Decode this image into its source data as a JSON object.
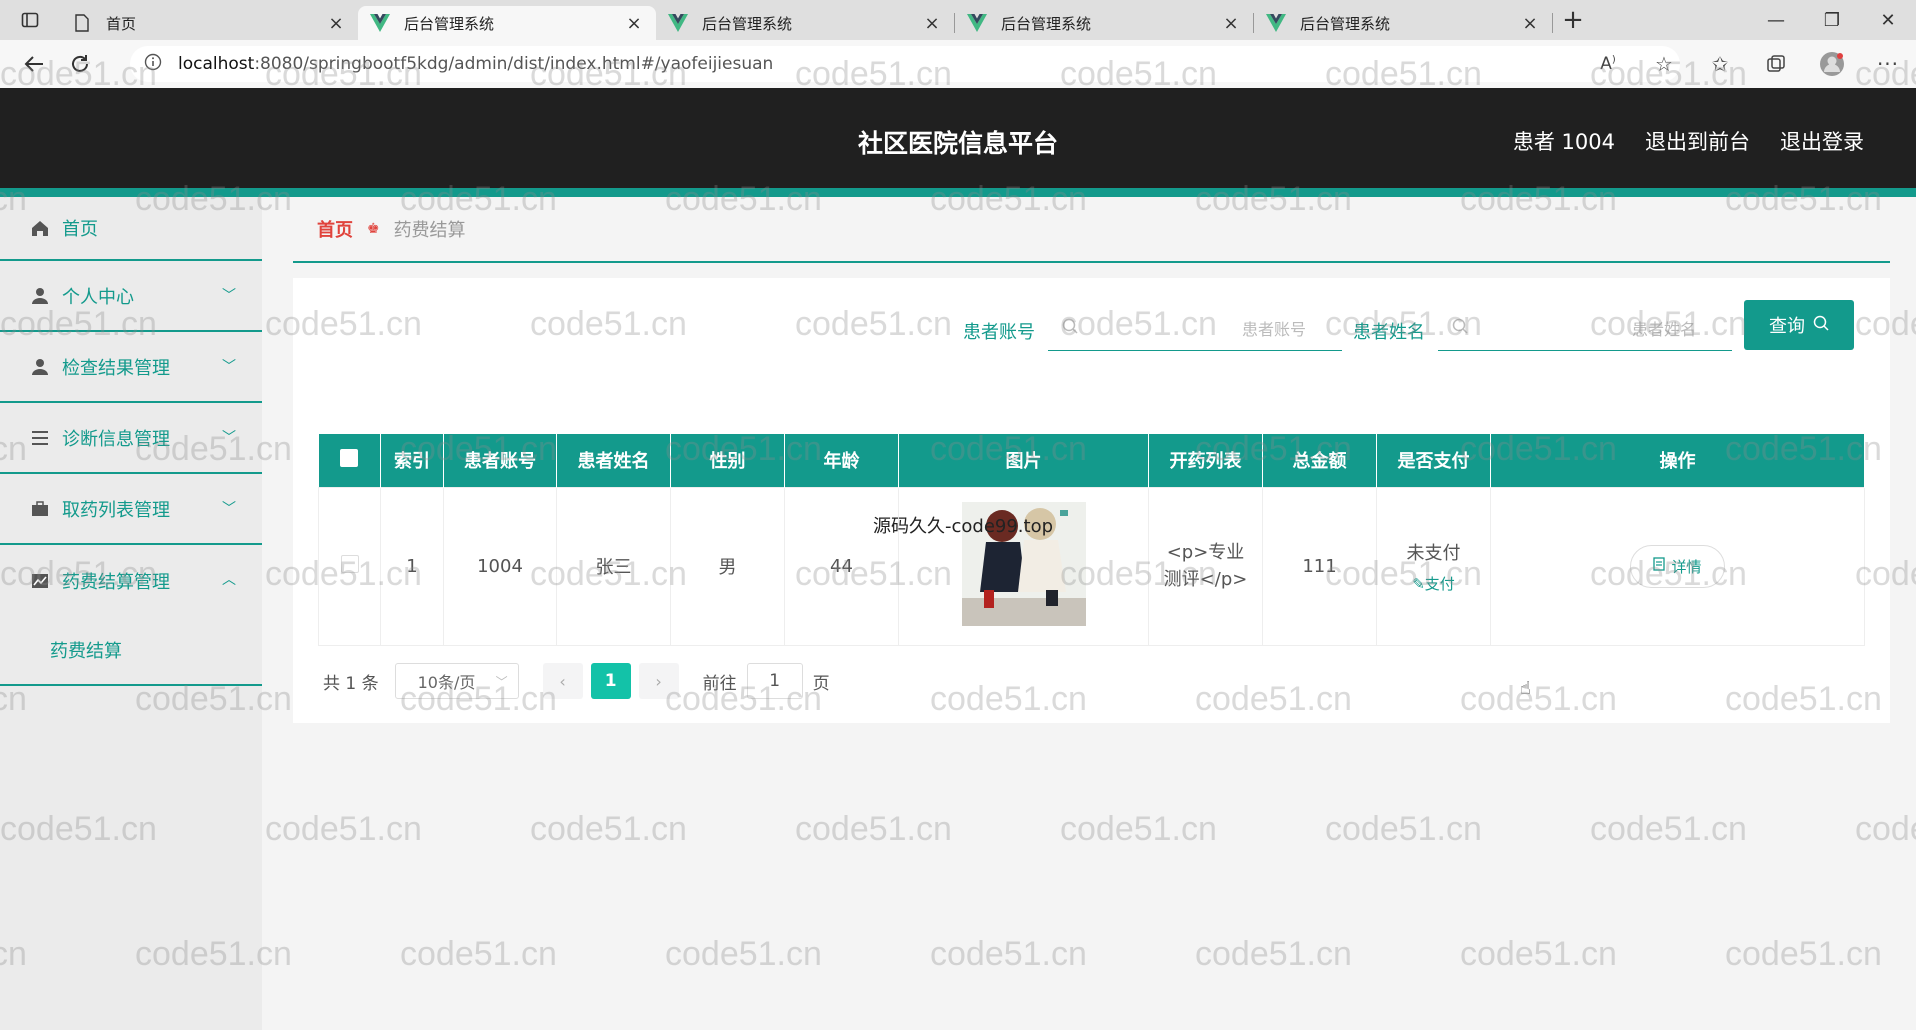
{
  "browser": {
    "tabs": [
      {
        "title": "首页",
        "active": false
      },
      {
        "title": "后台管理系统",
        "active": true
      },
      {
        "title": "后台管理系统",
        "active": false
      },
      {
        "title": "后台管理系统",
        "active": false
      },
      {
        "title": "后台管理系统",
        "active": false
      }
    ],
    "url_host": "localhost",
    "url_rest": ":8080/springbootf5kdg/admin/dist/index.html#/yaofeijiesuan"
  },
  "header": {
    "title": "社区医院信息平台",
    "user": "患者 1004",
    "to_front": "退出到前台",
    "logout": "退出登录"
  },
  "sidebar": {
    "items": [
      {
        "label": "首页",
        "icon": "home-icon"
      },
      {
        "label": "个人中心",
        "icon": "user-icon"
      },
      {
        "label": "检查结果管理",
        "icon": "user-icon"
      },
      {
        "label": "诊断信息管理",
        "icon": "list-icon"
      },
      {
        "label": "取药列表管理",
        "icon": "briefcase-icon"
      },
      {
        "label": "药费结算管理",
        "icon": "chart-icon"
      }
    ],
    "sub_items": [
      {
        "label": "药费结算"
      }
    ]
  },
  "breadcrumb": {
    "home": "首页",
    "current": "药费结算"
  },
  "search": {
    "account_label": "患者账号",
    "account_placeholder": "患者账号",
    "name_label": "患者姓名",
    "name_placeholder": "患者姓名",
    "button": "查询"
  },
  "table": {
    "headers": [
      "索引",
      "患者账号",
      "患者姓名",
      "性别",
      "年龄",
      "图片",
      "开药列表",
      "总金额",
      "是否支付",
      "操作"
    ],
    "rows": [
      {
        "index": "1",
        "account": "1004",
        "name": "张三",
        "gender": "男",
        "age": "44",
        "image_caption": "源码久久-code99.top",
        "drug_list_line1": "<p>专业",
        "drug_list_line2": "测评</p>",
        "total": "111",
        "paid_status": "未支付",
        "pay_action": "支付",
        "detail_action": "详情"
      }
    ]
  },
  "pagination": {
    "total": "共 1 条",
    "page_size": "10条/页",
    "current_page": "1",
    "goto_prefix": "前往",
    "goto_value": "1",
    "goto_suffix": "页"
  },
  "watermark": "code51.cn",
  "colors": {
    "accent": "#139a8c",
    "header_bg": "#202020",
    "breadcrumb_home": "#e0433c",
    "page_active": "#13c2a8"
  }
}
